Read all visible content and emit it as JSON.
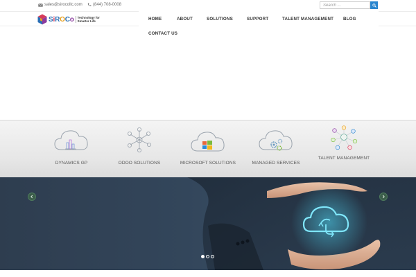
{
  "topbar": {
    "email": "sales@sirocollc.com",
    "phone": "(844) 708-0008",
    "search_placeholder": "Search ..."
  },
  "logo": {
    "letters": [
      "S",
      "i",
      "R",
      "O",
      "C",
      "o"
    ],
    "tagline_line1": "Technology for",
    "tagline_line2": "Smarter Life"
  },
  "nav": {
    "items": [
      {
        "label": "HOME"
      },
      {
        "label": "ABOUT"
      },
      {
        "label": "SOLUTIONS"
      },
      {
        "label": "SUPPORT"
      },
      {
        "label": "TALENT MANAGEMENT"
      },
      {
        "label": "BLOG"
      },
      {
        "label": "CONTACT US"
      }
    ]
  },
  "services": [
    {
      "label": "DYNAMICS GP",
      "icon": "cloud-chart-icon"
    },
    {
      "label": "ODOO SOLUTIONS",
      "icon": "network-nodes-icon"
    },
    {
      "label": "MICROSOFT SOLUTIONS",
      "icon": "cloud-windows-icon"
    },
    {
      "label": "MANAGED SERVICES",
      "icon": "cloud-gears-icon"
    },
    {
      "label": "TALENT MANAGEMENT",
      "icon": "people-network-icon"
    }
  ],
  "slider": {
    "prev_icon": "chevron-left-icon",
    "next_icon": "chevron-right-icon",
    "slide_count": 3,
    "active_slide": 1
  },
  "colors": {
    "accent_blue": "#2a86cf",
    "slider_bg": "#33465b",
    "cloud_glow": "#3fd0f0"
  }
}
